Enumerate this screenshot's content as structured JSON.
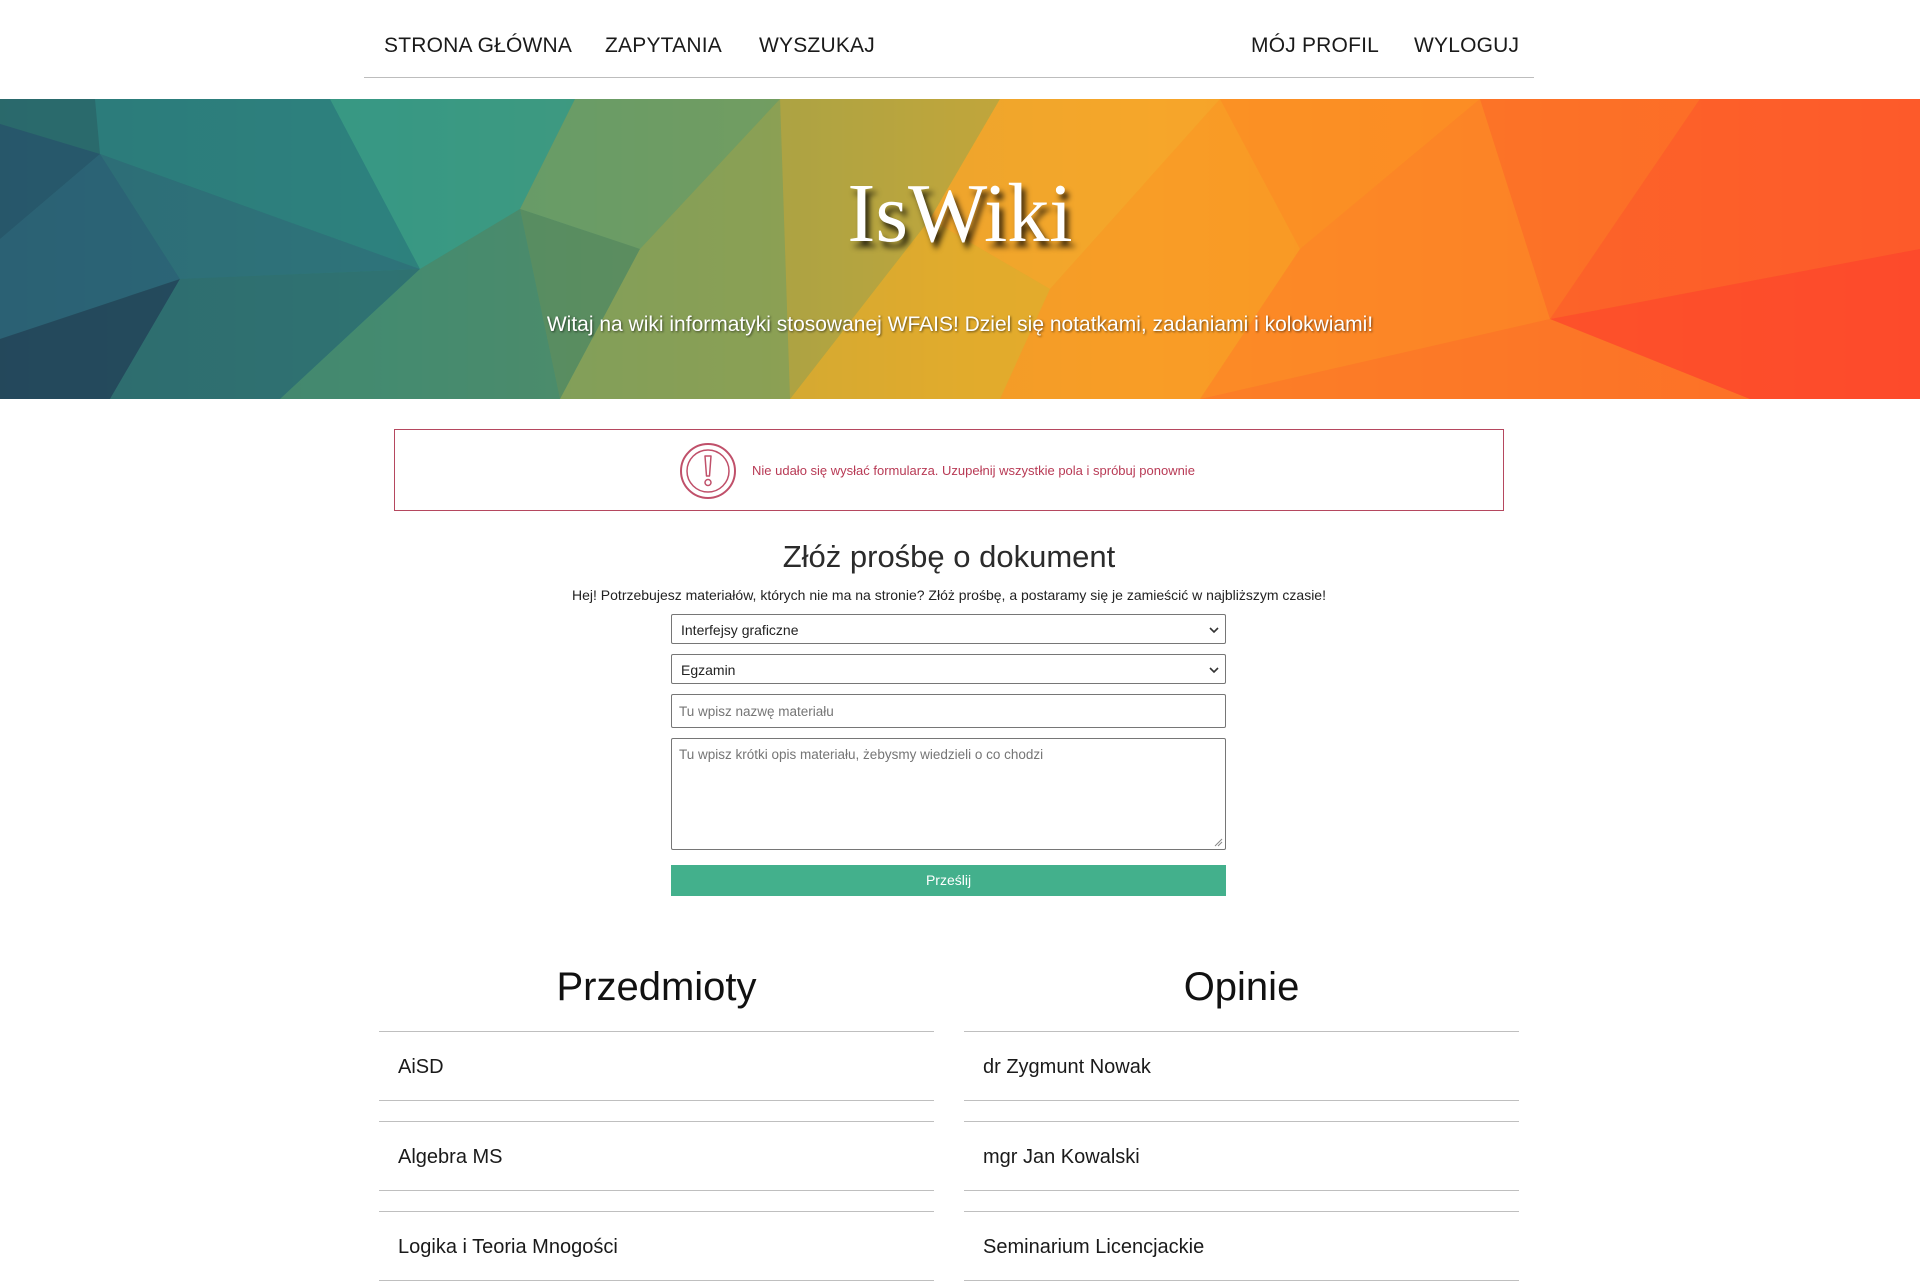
{
  "nav": {
    "home": "STRONA GŁÓWNA",
    "queries": "ZAPYTANIA",
    "search": "WYSZUKAJ",
    "profile": "MÓJ PROFIL",
    "logout": "WYLOGUJ"
  },
  "hero": {
    "title": "IsWiki",
    "subtitle": "Witaj na wiki informatyki stosowanej WFAIS! Dziel się notatkami, zadaniami i kolokwiami!"
  },
  "alert": {
    "icon": "exclamation-circle-icon",
    "message": "Nie udało się wysłać formularza. Uzupełnij wszystkie pola i spróbuj ponownie",
    "color": "#b83a55"
  },
  "form": {
    "title": "Złóż prośbę o dokument",
    "description": "Hej! Potrzebujesz materiałów, których nie ma na stronie? Złóż prośbę, a postaramy się je zamieścić w najbliższym czasie!",
    "subject_select": "Interfejsy graficzne",
    "type_select": "Egzamin",
    "name_placeholder": "Tu wpisz nazwę materiału",
    "description_placeholder": "Tu wpisz krótki opis materiału, żebysmy wiedzieli o co chodzi",
    "submit_label": "Prześlij",
    "submit_color": "#43b08c"
  },
  "subjects": {
    "title": "Przedmioty",
    "items": [
      "AiSD",
      "Algebra MS",
      "Logika i Teoria Mnogości"
    ]
  },
  "opinions": {
    "title": "Opinie",
    "items": [
      "dr Zygmunt Nowak",
      "mgr Jan Kowalski",
      "Seminarium Licencjackie"
    ]
  }
}
